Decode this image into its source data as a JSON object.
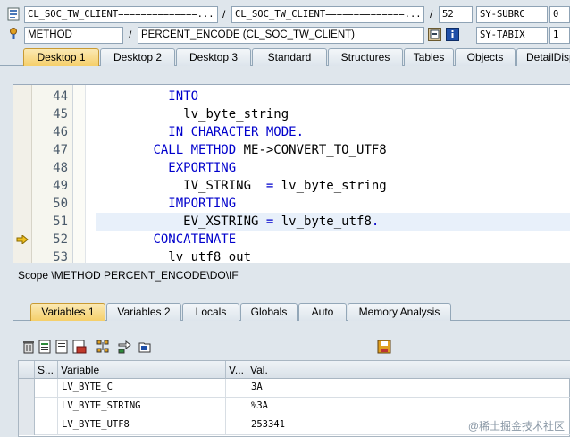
{
  "header": {
    "row1": {
      "program_field": "CL_SOC_TW_CLIENT==============...",
      "include_field": "CL_SOC_TW_CLIENT==============...",
      "line_field": "52",
      "sysvar_name": "SY-SUBRC",
      "sysvar_value": "0"
    },
    "row2": {
      "type_field": "METHOD",
      "name_field": "PERCENT_ENCODE (CL_SOC_TW_CLIENT)",
      "sysvar_name": "SY-TABIX",
      "sysvar_value": "1"
    },
    "separator": "/"
  },
  "top_tabs": [
    "Desktop 1",
    "Desktop 2",
    "Desktop 3",
    "Standard",
    "Structures",
    "Tables",
    "Objects",
    "DetailDisp"
  ],
  "editor": {
    "lines": [
      {
        "num": "44",
        "tokens": [
          {
            "t": "INTO",
            "k": "kw"
          }
        ],
        "indent": "          "
      },
      {
        "num": "45",
        "tokens": [
          {
            "t": "lv_byte_string",
            "k": "id"
          }
        ],
        "indent": "            "
      },
      {
        "num": "46",
        "tokens": [
          {
            "t": "IN CHARACTER MODE.",
            "k": "kw"
          }
        ],
        "indent": "          "
      },
      {
        "num": "47",
        "tokens": [
          {
            "t": "CALL METHOD ",
            "k": "kw"
          },
          {
            "t": "ME->CONVERT_TO_UTF8",
            "k": "id"
          }
        ],
        "indent": "        "
      },
      {
        "num": "48",
        "tokens": [
          {
            "t": "EXPORTING",
            "k": "kw"
          }
        ],
        "indent": "          "
      },
      {
        "num": "49",
        "tokens": [
          {
            "t": "IV_STRING  ",
            "k": "id"
          },
          {
            "t": "= ",
            "k": "kw"
          },
          {
            "t": "lv_byte_string",
            "k": "id"
          }
        ],
        "indent": "            "
      },
      {
        "num": "50",
        "tokens": [
          {
            "t": "IMPORTING",
            "k": "kw"
          }
        ],
        "indent": "          "
      },
      {
        "num": "51",
        "tokens": [
          {
            "t": "EV_XSTRING ",
            "k": "id"
          },
          {
            "t": "= ",
            "k": "kw"
          },
          {
            "t": "lv_byte_utf8",
            "k": "id"
          },
          {
            "t": ".",
            "k": "kw"
          }
        ],
        "indent": "            "
      },
      {
        "num": "52",
        "tokens": [
          {
            "t": "CONCATENATE",
            "k": "kw"
          }
        ],
        "indent": "        "
      },
      {
        "num": "53",
        "tokens": [
          {
            "t": "lv_utf8_out",
            "k": "id"
          }
        ],
        "indent": "          "
      }
    ],
    "current_line": "52",
    "highlighted_line": "51"
  },
  "scope": "Scope \\METHOD PERCENT_ENCODE\\DO\\IF",
  "bottom_tabs": [
    "Variables 1",
    "Variables 2",
    "Locals",
    "Globals",
    "Auto",
    "Memory Analysis"
  ],
  "grid": {
    "columns": [
      "S...",
      "Variable",
      "V...",
      "Val."
    ],
    "rows": [
      {
        "variable": "LV_BYTE_C",
        "value": "3A"
      },
      {
        "variable": "LV_BYTE_STRING",
        "value": "%3A"
      },
      {
        "variable": "LV_BYTE_UTF8",
        "value": "253341"
      }
    ]
  },
  "watermark": "@稀土掘金技术社区",
  "colors": {
    "keyword": "#0000cc",
    "active_tab": "#f5cf6a",
    "background": "#dfe6ec"
  }
}
